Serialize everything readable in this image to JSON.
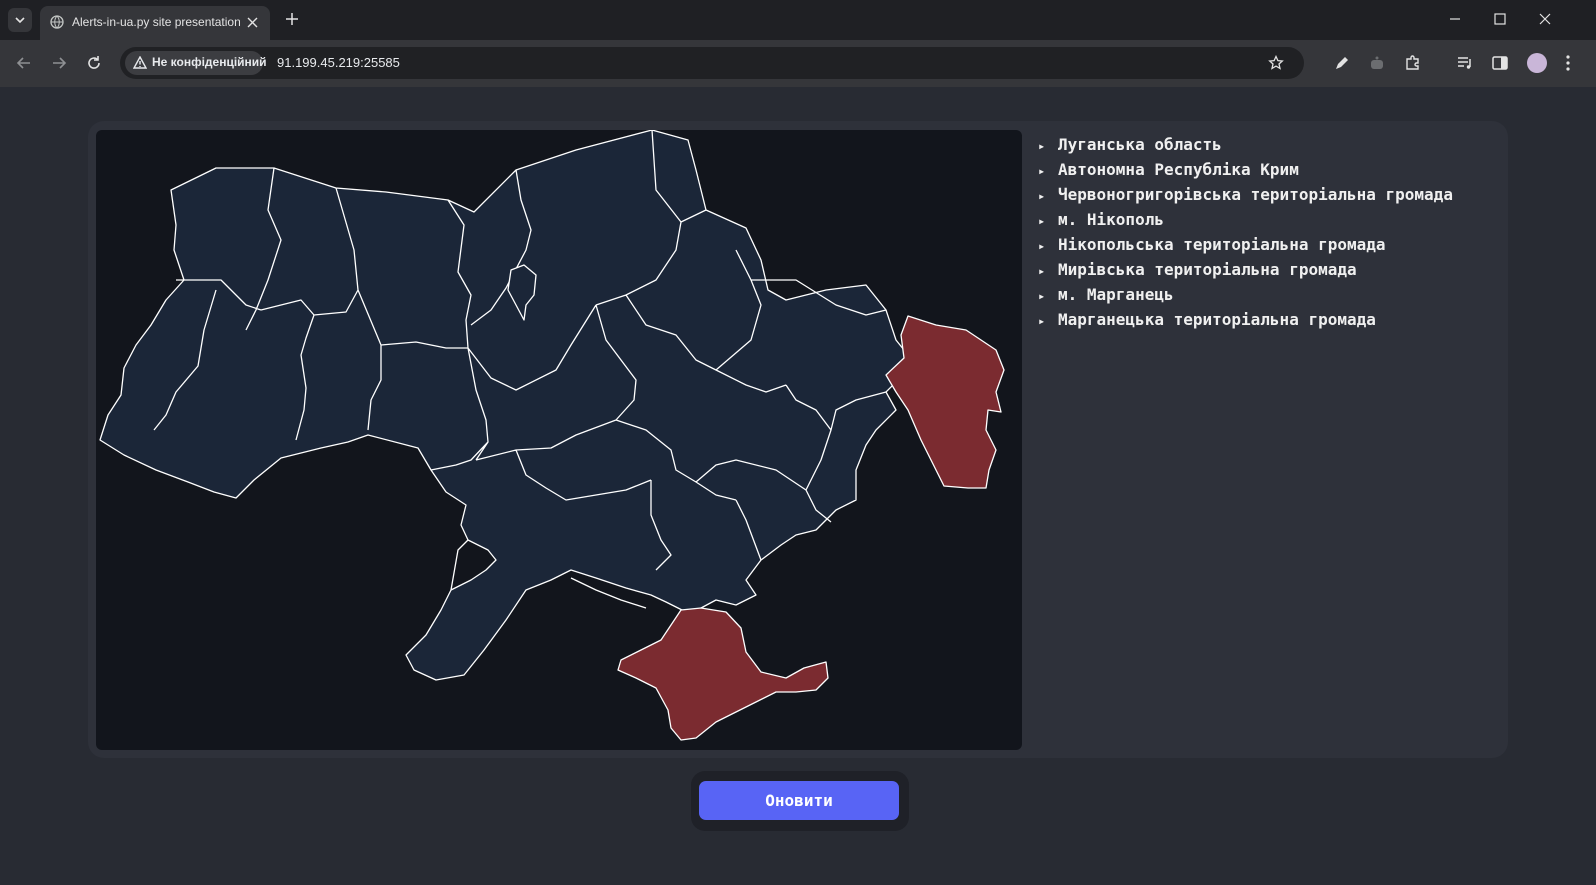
{
  "browser": {
    "tab_title": "Alerts-in-ua.py site presentation",
    "security_label": "Не конфіденційний",
    "url": "91.199.45.219:25585"
  },
  "icons": {
    "tab_menu": "chevron-down-icon",
    "favicon": "globe-icon",
    "close": "close-icon",
    "new_tab": "plus-icon",
    "back": "arrow-left-icon",
    "forward": "arrow-right-icon",
    "reload": "reload-icon",
    "warning": "warning-triangle-icon",
    "bookmark": "star-icon",
    "pen": "pen-icon",
    "extension": "puzzle-icon",
    "menu": "kebab-menu-icon"
  },
  "alerts": {
    "items": [
      "Луганська область",
      "Автономна Республіка Крим",
      "Червоногригорівська територіальна громада",
      "м. Нікополь",
      "Нікопольська територіальна громада",
      "Мирівська територіальна громада",
      "м. Марганець",
      "Марганецька територіальна громада"
    ]
  },
  "map": {
    "normal_color": "#1b2638",
    "alert_color": "#7b2b30",
    "border_color": "#ffffff",
    "alert_regions": [
      "Луганська область",
      "Автономна Республіка Крим"
    ]
  },
  "refresh_button": {
    "label": "Оновити"
  },
  "colors": {
    "accent": "#5864f5",
    "page_bg": "#282b33",
    "panel_bg": "#2e313a"
  }
}
